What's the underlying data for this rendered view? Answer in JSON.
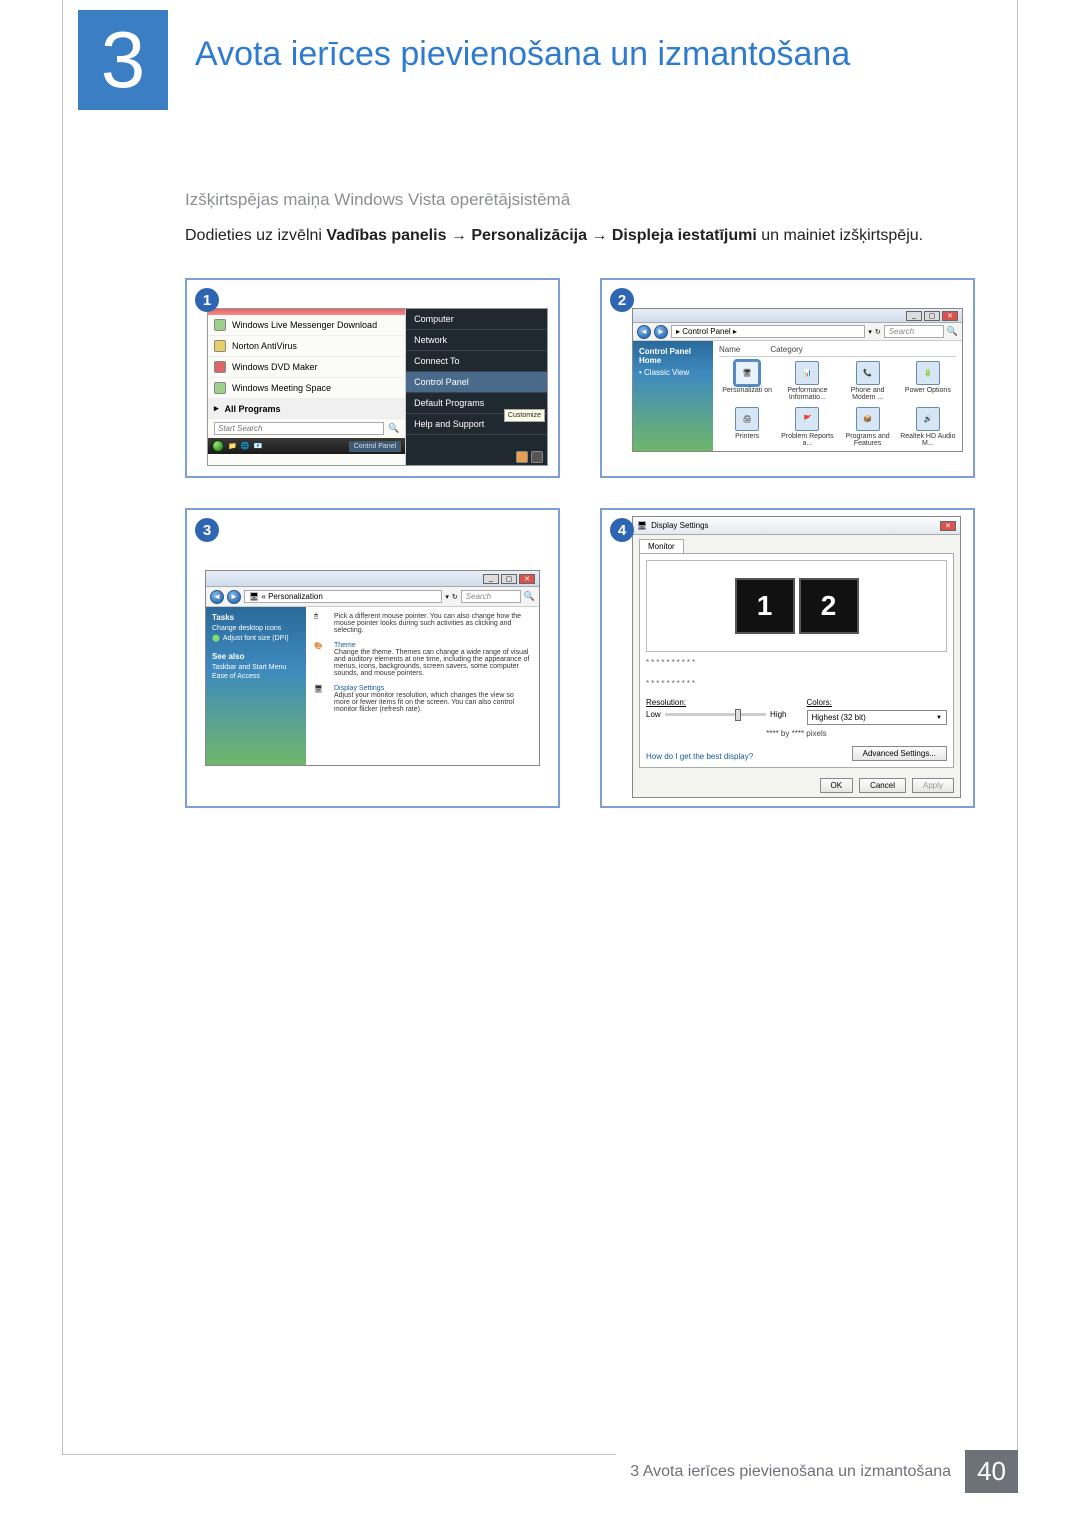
{
  "chapter": {
    "number": "3",
    "title": "Avota ierīces pievienošana un izmantošana"
  },
  "subheading": "Izšķirtspējas maiņa Windows Vista operētājsistēmā",
  "instruction": {
    "prefix": "Dodieties uz izvēlni ",
    "b1": "Vadības panelis",
    "arrow": " → ",
    "b2": "Personalizācija",
    "b3": "Displeja iestatījumi",
    "suffix": " un mainiet izšķirtspēju."
  },
  "panels": {
    "p1": {
      "num": "1",
      "left_items": [
        "Windows Live Messenger Download",
        "Norton AntiVirus",
        "Windows DVD Maker",
        "Windows Meeting Space"
      ],
      "all_programs": "All Programs",
      "search_placeholder": "Start Search",
      "right_items": [
        "Computer",
        "Network",
        "Connect To",
        "Control Panel",
        "Default Programs",
        "Help and Support"
      ],
      "tooltip": "Customize",
      "taskbar_item": "Control Panel"
    },
    "p2": {
      "num": "2",
      "breadcrumb": "▸ Control Panel ▸",
      "search": "Search",
      "side": {
        "home": "Control Panel Home",
        "classic": "Classic View"
      },
      "cols": {
        "name": "Name",
        "category": "Category"
      },
      "icons": [
        "Personalizati on",
        "Performance Informatio...",
        "Phone and Modem ...",
        "Power Options",
        "Printers",
        "Problem Reports a...",
        "Programs and Features",
        "Realtek HD Audio M..."
      ]
    },
    "p3": {
      "num": "3",
      "breadcrumb": "« Personalization",
      "search": "Search",
      "side": {
        "tasks": "Tasks",
        "task_items": [
          "Change desktop icons",
          "Adjust font size (DPI)"
        ],
        "see_also": "See also",
        "see_items": [
          "Taskbar and Start Menu",
          "Ease of Access"
        ]
      },
      "main": {
        "mouse_title": "Pick a different mouse pointer. You can also change how the mouse pointer looks during such activities as clicking and selecting.",
        "theme_title": "Theme",
        "theme_body": "Change the theme. Themes can change a wide range of visual and auditory elements at one time, including the appearance of menus, icons, backgrounds, screen savers, some computer sounds, and mouse pointers.",
        "display_title": "Display Settings",
        "display_body": "Adjust your monitor resolution, which changes the view so more or fewer items fit on the screen. You can also control monitor flicker (refresh rate)."
      }
    },
    "p4": {
      "num": "4",
      "title": "Display Settings",
      "tab": "Monitor",
      "mon1": "1",
      "mon2": "2",
      "dots": "**********",
      "res_label": "Resolution:",
      "low": "Low",
      "high": "High",
      "pixels": "**** by **** pixels",
      "colors_label": "Colors:",
      "colors_value": "Highest (32 bit)",
      "link": "How do I get the best display?",
      "adv": "Advanced Settings...",
      "ok": "OK",
      "cancel": "Cancel",
      "apply": "Apply"
    }
  },
  "footer": {
    "text": "3 Avota ierīces pievienošana un izmantošana",
    "page": "40"
  }
}
